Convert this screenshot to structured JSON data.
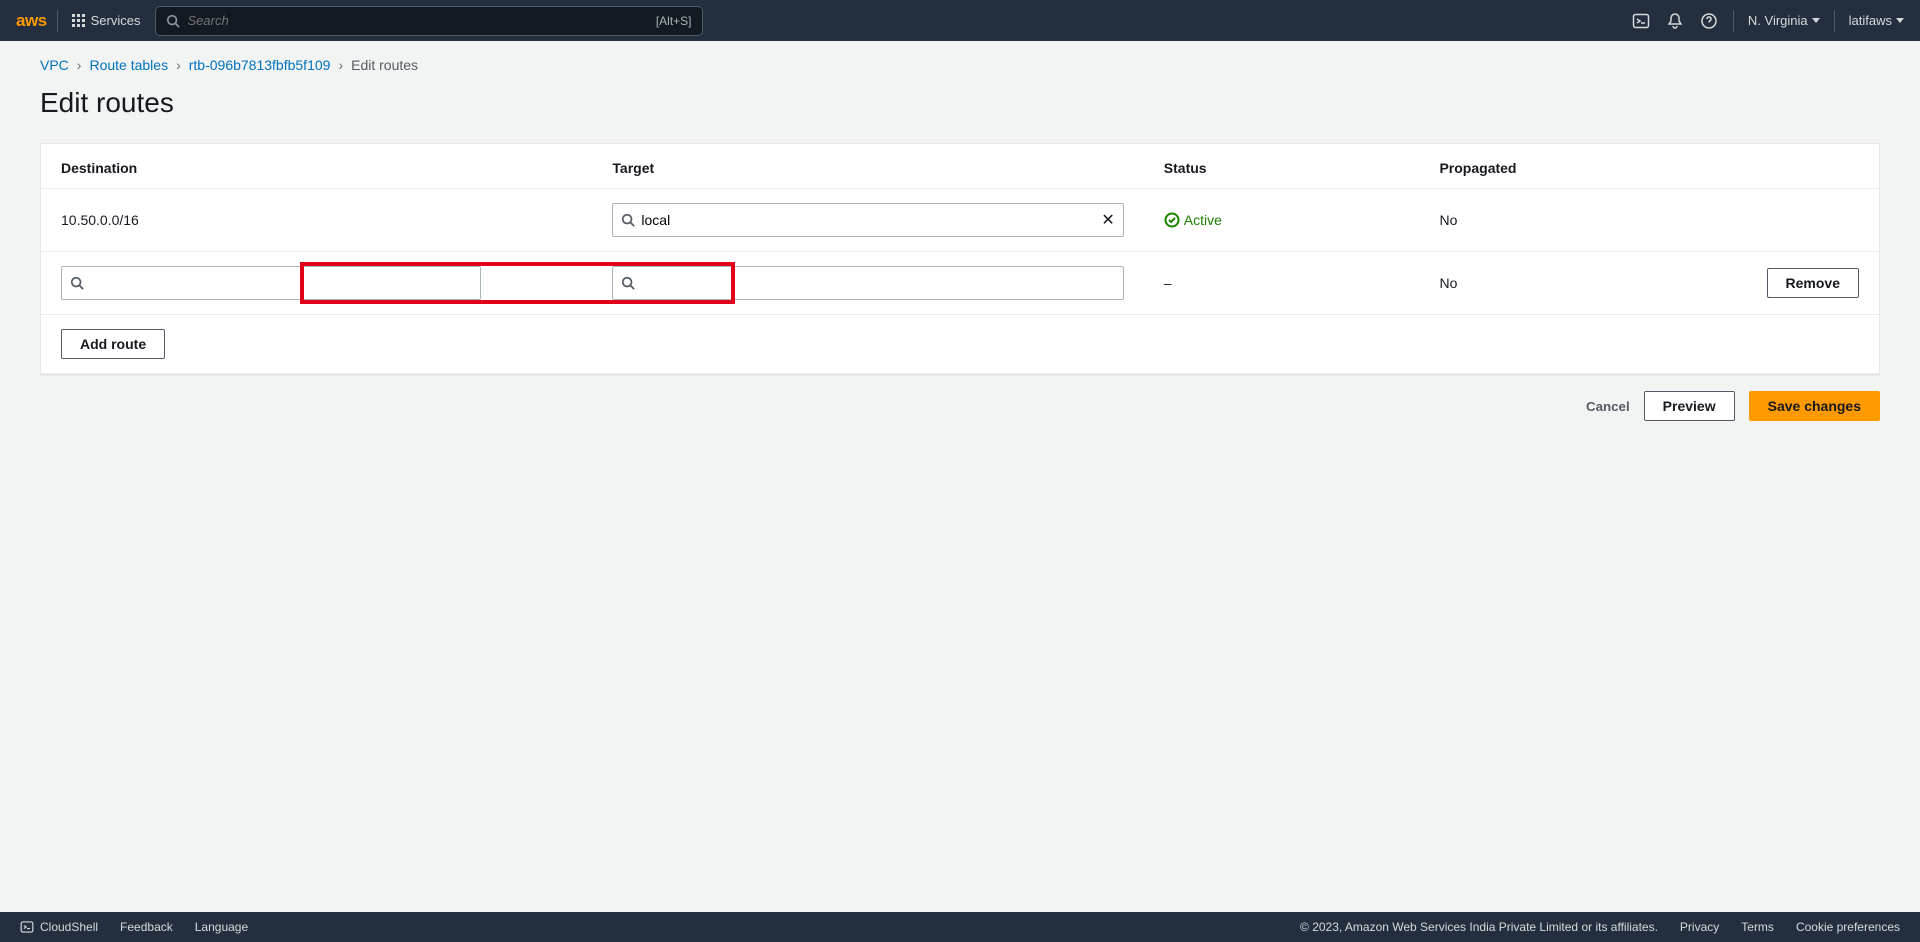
{
  "topnav": {
    "logo_text": "aws",
    "services_label": "Services",
    "search_placeholder": "Search",
    "search_shortcut": "[Alt+S]",
    "region": "N. Virginia",
    "account": "latifaws"
  },
  "breadcrumb": {
    "items": [
      "VPC",
      "Route tables",
      "rtb-096b7813fbfb5f109"
    ],
    "current": "Edit routes"
  },
  "page_title": "Edit routes",
  "table": {
    "headers": {
      "destination": "Destination",
      "target": "Target",
      "status": "Status",
      "propagated": "Propagated"
    },
    "rows": [
      {
        "destination_text": "10.50.0.0/16",
        "target_value": "local",
        "status": "Active",
        "propagated": "No",
        "removable": false
      },
      {
        "destination_text": "",
        "target_value": "",
        "status": "–",
        "propagated": "No",
        "removable": true
      }
    ],
    "add_route_label": "Add route",
    "remove_label": "Remove"
  },
  "actions": {
    "cancel": "Cancel",
    "preview": "Preview",
    "save": "Save changes"
  },
  "footer": {
    "cloudshell": "CloudShell",
    "feedback": "Feedback",
    "language": "Language",
    "copyright": "© 2023, Amazon Web Services India Private Limited or its affiliates.",
    "privacy": "Privacy",
    "terms": "Terms",
    "cookies": "Cookie preferences"
  }
}
